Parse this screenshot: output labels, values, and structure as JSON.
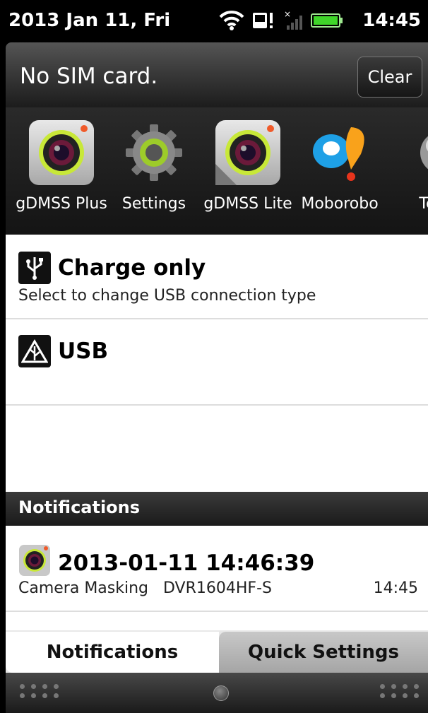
{
  "status_bar": {
    "date": "2013 Jan 11, Fri",
    "time": "14:45",
    "icons": [
      "wifi-icon",
      "sd-card-warning-icon",
      "no-signal-icon",
      "battery-icon"
    ]
  },
  "sim_bar": {
    "message": "No SIM card.",
    "clear_label": "Clear"
  },
  "apps": [
    {
      "label": "gDMSS Plus",
      "icon": "camera-app-icon"
    },
    {
      "label": "Settings",
      "icon": "gear-icon"
    },
    {
      "label": "gDMSS Lite",
      "icon": "camera-lite-app-icon"
    },
    {
      "label": "Moborobo",
      "icon": "moborobo-icon"
    },
    {
      "label": "Tec",
      "icon": "globe-icon"
    }
  ],
  "ongoing": {
    "usb_mode": {
      "title": "Charge only",
      "subtitle": "Select to change USB connection type"
    },
    "usb_debug": {
      "title": "USB"
    }
  },
  "notifications": {
    "header": "Notifications",
    "items": [
      {
        "title": "2013-01-11 14:46:39",
        "text": "Camera Masking   DVR1604HF-S",
        "time": "14:45"
      }
    ]
  },
  "tabs": {
    "notifications": "Notifications",
    "quick_settings": "Quick Settings"
  }
}
